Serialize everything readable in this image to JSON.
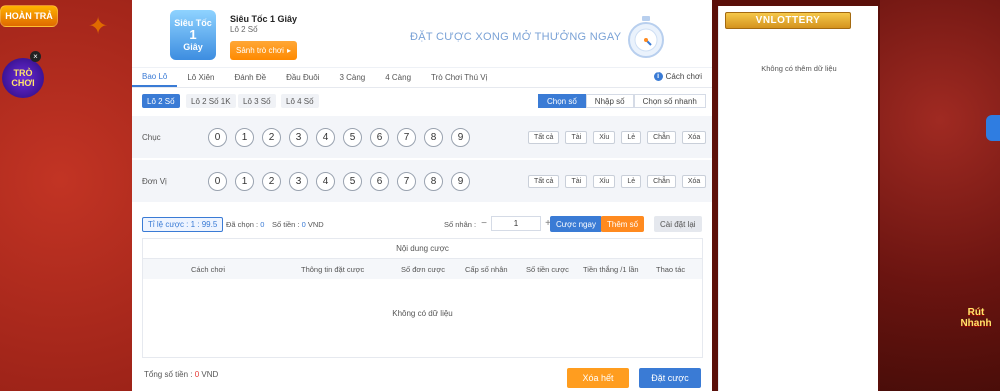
{
  "promos": {
    "hoantra": "HOÀN TRẢ",
    "trochoi_line1": "TRÒ",
    "trochoi_line2": "CHƠI",
    "rutnhanh_line1": "Rút",
    "rutnhanh_line2": "Nhanh"
  },
  "header": {
    "logo_line1": "Siêu Tốc",
    "logo_line2": "1",
    "logo_line3": "Giây",
    "title": "Siêu Tốc 1 Giây",
    "subtitle": "Lô 2 Số",
    "lobby_button": "Sảnh trò chơi",
    "lobby_arrow": "▸",
    "slogan": "ĐẶT CƯỢC XONG MỞ THƯỞNG NGAY"
  },
  "tabs": [
    {
      "label": "Bao Lô",
      "active": true
    },
    {
      "label": "Lô Xiên",
      "active": false
    },
    {
      "label": "Đánh Đề",
      "active": false
    },
    {
      "label": "Đầu Đuôi",
      "active": false
    },
    {
      "label": "3 Càng",
      "active": false
    },
    {
      "label": "4 Càng",
      "active": false
    },
    {
      "label": "Trò Chơi Thú Vị",
      "active": false
    }
  ],
  "rules_link": "Cách chơi",
  "info_icon": "i",
  "subtypes": [
    "Lô 2 Số",
    "Lô 2 Số 1K",
    "Lô 3 Số",
    "Lô 4 Số"
  ],
  "modes": [
    "Chọn số",
    "Nhập số",
    "Chọn số nhanh"
  ],
  "rows": [
    {
      "label": "Chục"
    },
    {
      "label": "Đơn Vị"
    }
  ],
  "digits": [
    "0",
    "1",
    "2",
    "3",
    "4",
    "5",
    "6",
    "7",
    "8",
    "9"
  ],
  "filters": [
    "Tất cả",
    "Tài",
    "Xỉu",
    "Lẻ",
    "Chẵn",
    "Xóa"
  ],
  "action": {
    "odds": "Tỉ lệ cược : 1 : 99.5",
    "selected_label": "Đã chọn :",
    "selected_value": "0",
    "amount_label": "Số tiền :",
    "amount_value": "0",
    "amount_unit": "VND",
    "multiplier_label": "Số nhân :",
    "minus": "−",
    "plus": "+",
    "multiplier_value": "1",
    "quick_bet": "Cược ngay",
    "add_number": "Thêm số",
    "reset": "Cài đặt lại"
  },
  "bet_table": {
    "title": "Nội dung cược",
    "columns": [
      "Cách chơi",
      "Thông tin đặt cược",
      "Số đơn cược",
      "Cấp số nhân",
      "Số tiền cược",
      "Tiền thắng /1 lần",
      "Thao tác"
    ],
    "empty": "Không có dữ liệu"
  },
  "footer": {
    "total_label": "Tổng số tiền :",
    "total_value": "0",
    "total_unit": "VND",
    "clear_all": "Xóa hết",
    "place_bet": "Đặt cược"
  },
  "panel": {
    "brand": "VNLOTTERY",
    "empty": "Không có thêm dữ liệu"
  },
  "colors": {
    "accent": "#3a7bd5",
    "orange": "#ff8a1f",
    "negative": "#e53935"
  }
}
